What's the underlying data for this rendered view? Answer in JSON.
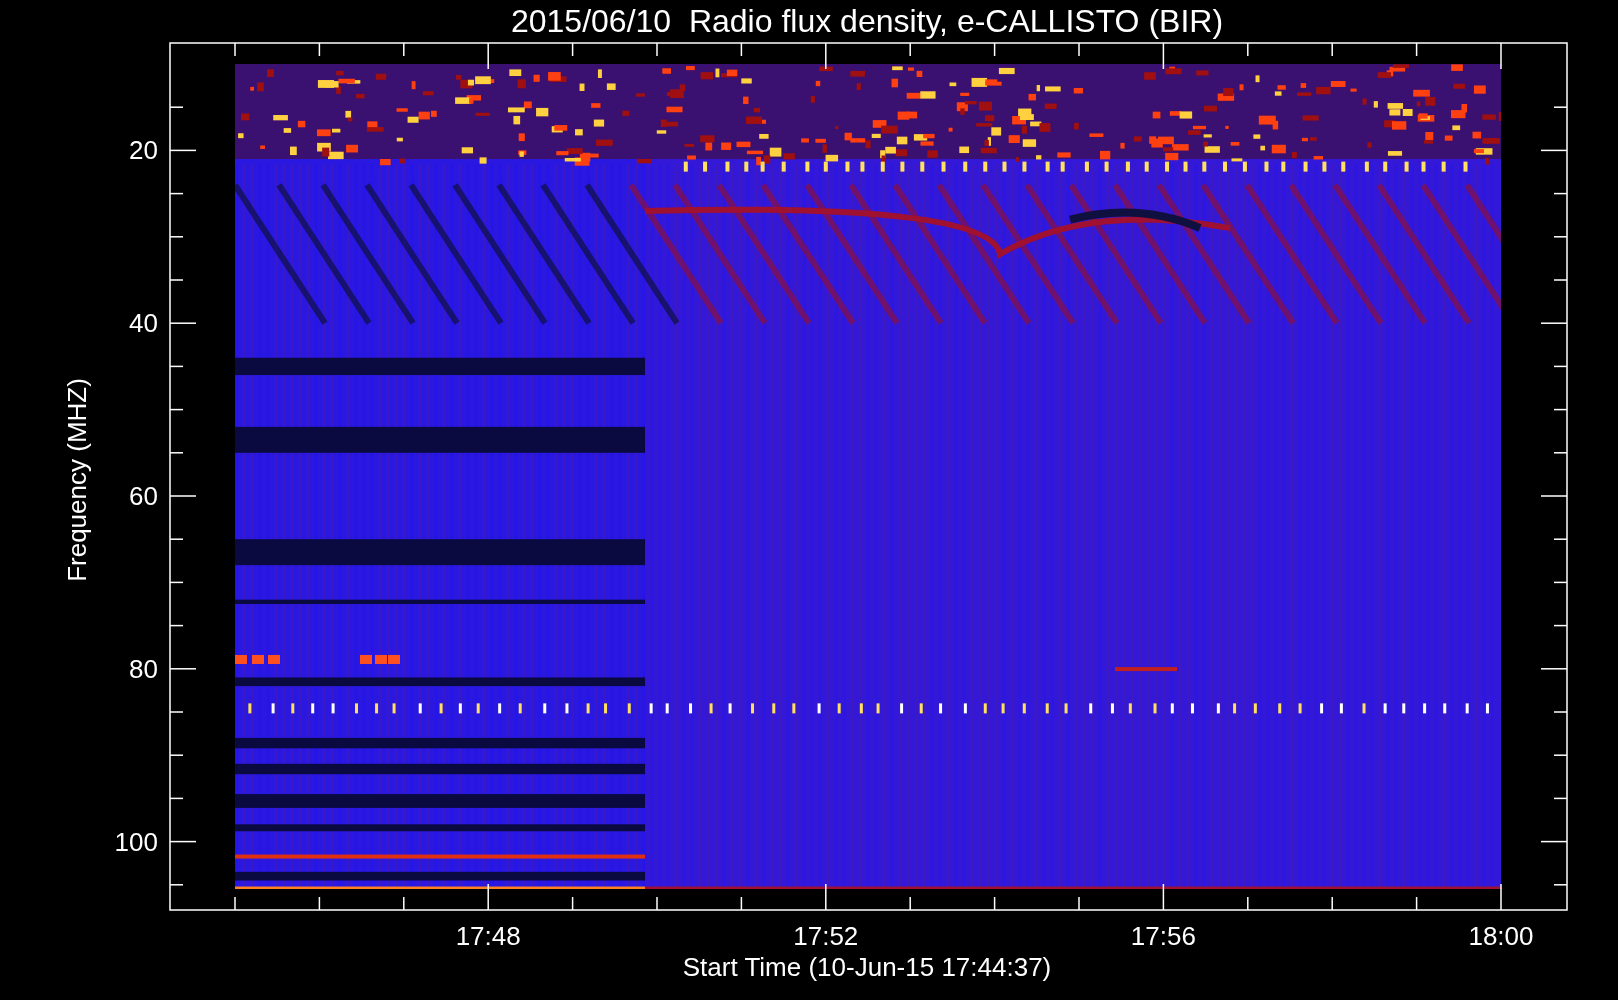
{
  "title": "2015/06/10  Radio flux density, e-CALLISTO (BIR)",
  "y_axis": {
    "label": "Frequency (MHZ)",
    "tick_labels": [
      "20",
      "40",
      "60",
      "80",
      "100"
    ]
  },
  "x_axis": {
    "label": "Start Time (10-Jun-15 17:44:37)",
    "tick_labels": [
      "17:48",
      "17:52",
      "17:56",
      "18:00"
    ]
  }
}
